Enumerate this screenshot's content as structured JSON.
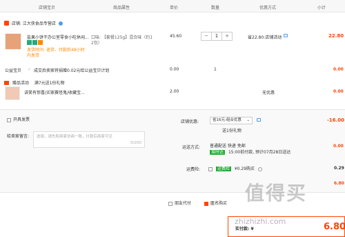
{
  "header": {
    "shop_treasure": "店铺宝贝",
    "attrs": "商品属性",
    "price": "单价",
    "qty": "数量",
    "discount": "优惠方式",
    "subtotal": "小计"
  },
  "shop": {
    "name": "店铺: 江大侠食品专营店"
  },
  "item": {
    "title": "盐果小饼干办公室零食小吃休闲...",
    "attrs_line1": "口味: 【套餐125g】混合味（约1",
    "attrs_line2": "2包）",
    "promise_line1": "发货时间: 退货、付款后48小时",
    "promise_line2": "内发货",
    "price": "45.60",
    "qty": "1",
    "discount": "省22.80:店铺活动",
    "subtotal": "22.80"
  },
  "charity": {
    "label": "公益宝贝",
    "desc": "成交后卖家将捐赠0.02元给公益宝贝计划",
    "price": "0.00",
    "qty": "1",
    "subtotal": "0.00"
  },
  "gift": {
    "section_label": "赠品活动",
    "section_desc": "满7元送1份礼物",
    "title": "讲笑有惊喜/买家赛怪鬼/收藏宝...",
    "price": "2.00",
    "discount": "无优惠",
    "subtotal": "0.00"
  },
  "invoice": {
    "label": "开具发票"
  },
  "message": {
    "label": "给卖家留言:",
    "placeholder": "选填，请先和商家协商一致，付款后商家可见",
    "counter": "0/200"
  },
  "shop_discount": {
    "label": "店铺优惠:",
    "selected": "省16元:组合优惠",
    "sub": "送1份礼物",
    "amount": "-16.00"
  },
  "shipping": {
    "label": "运送方式:",
    "method": "普通配送 快递 免邮",
    "tag": "准时达",
    "eta": "15:00前付款, 预计07月28日送达",
    "amount": "0.00"
  },
  "insurance": {
    "label": "运费险:",
    "tag": "运费险",
    "price": "¥0.29购买",
    "amount": "0.29"
  },
  "store_total": {
    "amount": "6.80"
  },
  "footer": {
    "friend_pay": "朋友代付",
    "anon": "匿名购买",
    "pay_label": "实付款: ¥",
    "pay_total": "6.80"
  },
  "watermark": {
    "line1": "值得买",
    "line2": "zhizhizhi.com"
  },
  "colors": {
    "accent": "#ff4400",
    "green": "#22aa33",
    "blue": "#4a9cf0"
  }
}
